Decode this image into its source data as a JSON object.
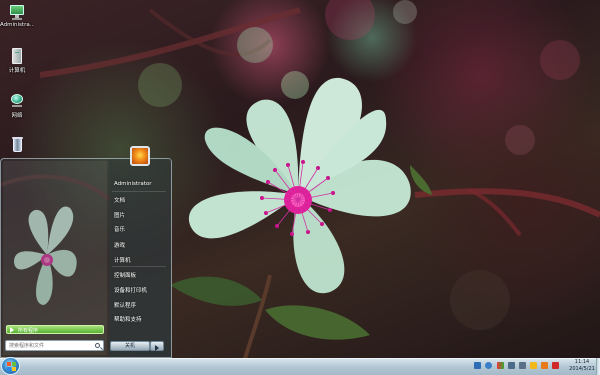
{
  "desktop": {
    "icons": [
      {
        "label": "Administra...",
        "icon": "user-folder-icon"
      },
      {
        "label": "计算机",
        "icon": "computer-icon"
      },
      {
        "label": "网络",
        "icon": "network-icon"
      },
      {
        "label": "",
        "icon": "recycle-bin-icon"
      }
    ]
  },
  "start_menu": {
    "user_name": "Administrator",
    "right_items": [
      "文档",
      "图片",
      "音乐",
      "游戏",
      "计算机",
      "控制面板",
      "设备和打印机",
      "默认程序",
      "帮助和支持"
    ],
    "all_programs": "所有程序",
    "search_placeholder": "搜索程序和文件",
    "shutdown_label": "关机"
  },
  "taskbar": {
    "time": "11:14",
    "date": "2014/5/21",
    "tray_icons": [
      "language-icon",
      "help-icon",
      "flag-icon",
      "network-icon",
      "volume-icon",
      "app-icon",
      "app-icon",
      "app-icon"
    ]
  },
  "colors": {
    "all_programs_green": "#58b133",
    "taskbar": "#b2c6d3",
    "flower_petal": "#cfeee0",
    "stamen": "#e0209a"
  }
}
